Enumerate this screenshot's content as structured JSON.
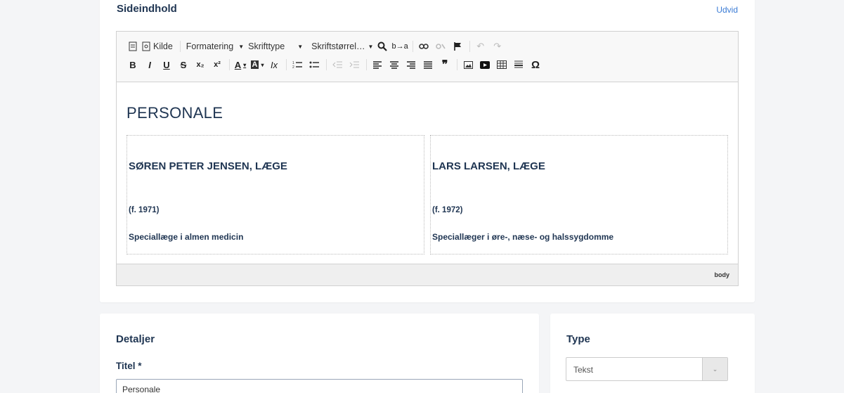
{
  "content_section": {
    "title": "Sideindhold",
    "expand_label": "Udvid"
  },
  "toolbar": {
    "source_label": "Kilde",
    "format_label": "Formatering",
    "font_label": "Skrifttype",
    "size_label": "Skriftstørrel…",
    "bold": "B",
    "italic": "I",
    "underline": "U",
    "strike": "S",
    "subscript": "x₂",
    "superscript": "x²",
    "text_color": "A",
    "bg_color": "A",
    "remove_format": "Ix",
    "blockquote": "❞",
    "special_char": "Ω"
  },
  "editor": {
    "heading": "PERSONALE",
    "columns": [
      {
        "name": "SØREN PETER JENSEN, LÆGE",
        "year": "(f. 1971)",
        "specialty": "Speciallæge i almen medicin"
      },
      {
        "name": "LARS LARSEN, LÆGE",
        "year": "(f. 1972)",
        "specialty": "Speciallæger i øre-, næse- og halssygdomme"
      }
    ],
    "element_path": "body"
  },
  "details": {
    "title": "Detaljer",
    "title_field_label": "Titel *",
    "title_field_value": "Personale"
  },
  "type_panel": {
    "title": "Type",
    "selected": "Tekst"
  }
}
